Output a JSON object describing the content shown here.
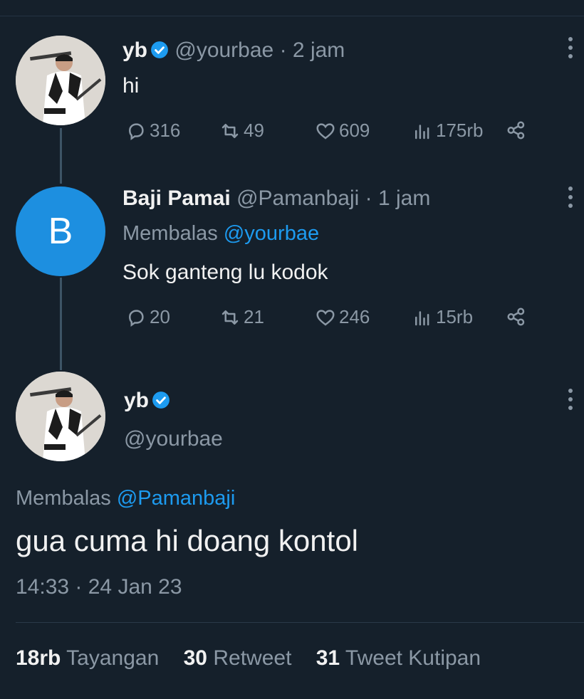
{
  "tweet1": {
    "name": "yb",
    "handle": "@yourbae",
    "dot": "·",
    "time": "2 jam",
    "text": "hi",
    "replies": "316",
    "retweets": "49",
    "likes": "609",
    "views": "175rb"
  },
  "tweet2": {
    "avatar_letter": "B",
    "name": "Baji Pamai",
    "handle": "@Pamanbaji",
    "dot": "·",
    "time": "1 jam",
    "reply_label": "Membalas",
    "reply_mention": "@yourbae",
    "text": "Sok ganteng lu kodok",
    "replies": "20",
    "retweets": "21",
    "likes": "246",
    "views": "15rb"
  },
  "main_tweet": {
    "name": "yb",
    "handle": "@yourbae",
    "reply_label": "Membalas",
    "reply_mention": "@Pamanbaji",
    "text": "gua cuma hi doang kontol",
    "timestamp": "14:33 · 24 Jan 23",
    "stats": {
      "views_count": "18rb",
      "views_label": "Tayangan",
      "retweets_count": "30",
      "retweets_label": "Retweet",
      "quotes_count": "31",
      "quotes_label": "Tweet Kutipan"
    }
  },
  "icons": {
    "reply": "reply-icon",
    "retweet": "retweet-icon",
    "like": "heart-icon",
    "views": "views-icon",
    "share": "share-icon",
    "verified": "verified-badge-icon",
    "more": "more-vertical-icon"
  },
  "colors": {
    "background": "#15202b",
    "accent": "#1d9bf0",
    "muted": "#8b98a5",
    "text": "#f1f1f1",
    "avatar_b": "#1d8fe0"
  }
}
